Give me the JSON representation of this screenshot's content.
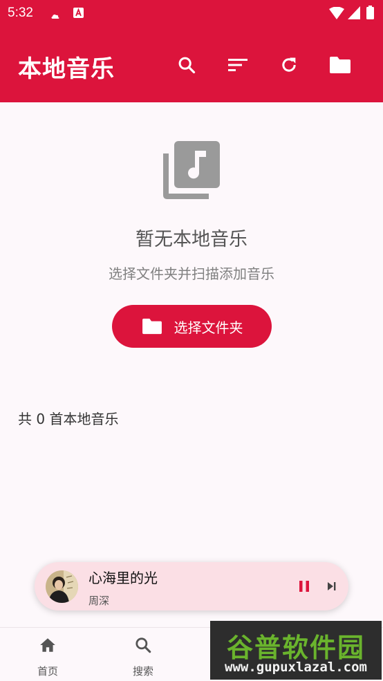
{
  "status_bar": {
    "time": "5:32"
  },
  "app_bar": {
    "title": "本地音乐"
  },
  "empty_state": {
    "title": "暂无本地音乐",
    "subtitle": "选择文件夹并扫描添加音乐",
    "button_label": "选择文件夹"
  },
  "library": {
    "count_text": "共 0 首本地音乐"
  },
  "mini_player": {
    "song_title": "心海里的光",
    "artist": "周深"
  },
  "bottom_nav": {
    "items": [
      {
        "label": "首页",
        "icon": "home-icon"
      },
      {
        "label": "搜索",
        "icon": "search-icon"
      }
    ]
  },
  "watermark": {
    "brand": "谷普软件园",
    "url": "www.gupuxlazal.com"
  },
  "colors": {
    "primary": "#dc143c",
    "player_bg": "#fbdfe5",
    "background": "#fdf8fb"
  }
}
